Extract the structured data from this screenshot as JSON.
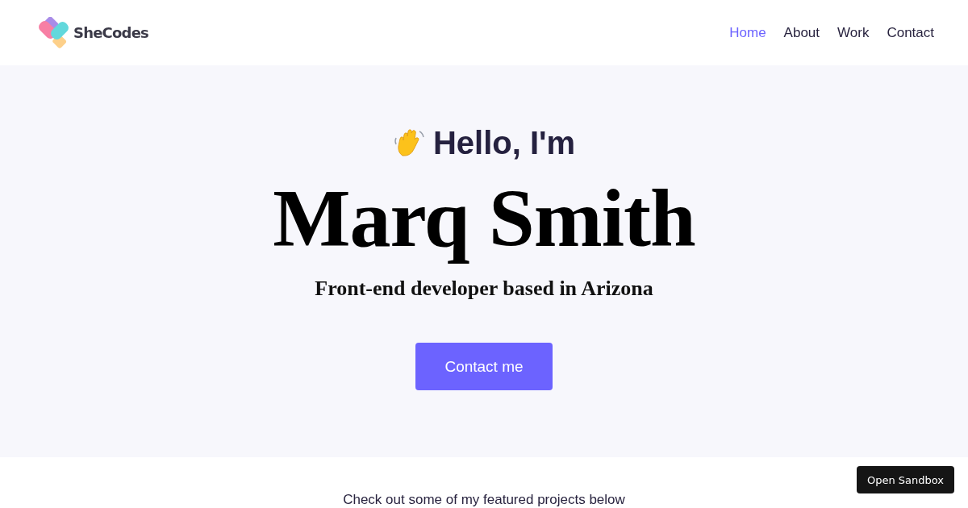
{
  "logo": {
    "text": "SheCodes"
  },
  "nav": [
    {
      "label": "Home",
      "selected": true
    },
    {
      "label": "About",
      "selected": false
    },
    {
      "label": "Work",
      "selected": false
    },
    {
      "label": "Contact",
      "selected": false
    }
  ],
  "hero": {
    "greeting": "Hello, I'm",
    "name": "Marq Smith",
    "tagline": "Front-end developer based in Arizona",
    "button": "Contact me"
  },
  "projects": {
    "intro": "Check out some of my featured projects below"
  },
  "sandbox_button": "Open Sandbox"
}
